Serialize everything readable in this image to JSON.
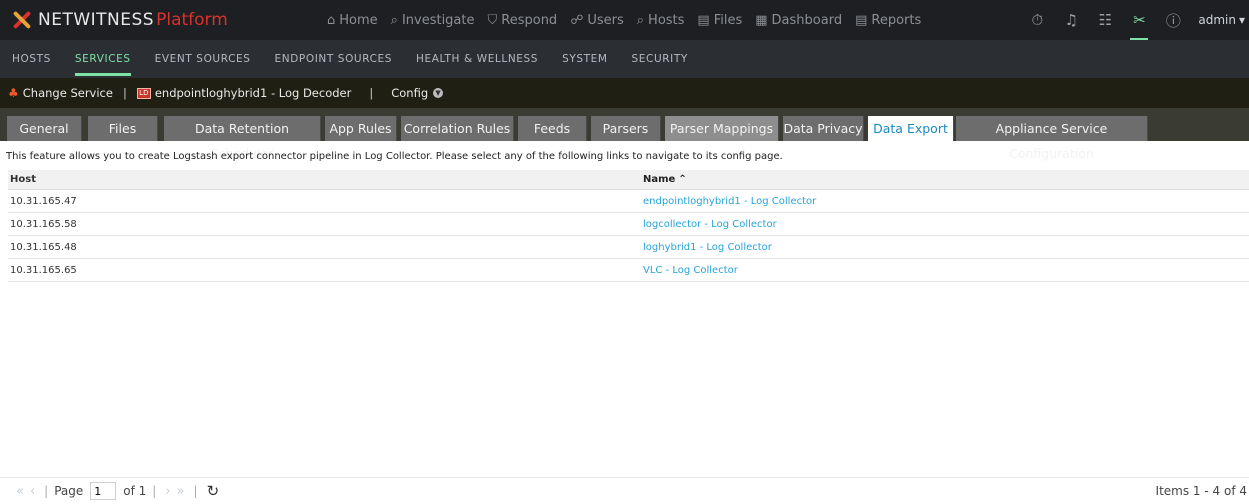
{
  "brand": {
    "name": "NETWITNESS",
    "product": "Platform"
  },
  "main_nav": [
    {
      "label": "Home",
      "icon": "home-icon",
      "glyph": "⌂"
    },
    {
      "label": "Investigate",
      "icon": "investigate-icon",
      "glyph": "⌕"
    },
    {
      "label": "Respond",
      "icon": "respond-icon",
      "glyph": "⛉"
    },
    {
      "label": "Users",
      "icon": "users-icon",
      "glyph": "☍"
    },
    {
      "label": "Hosts",
      "icon": "hosts-icon",
      "glyph": "⌕"
    },
    {
      "label": "Files",
      "icon": "files-icon",
      "glyph": "▤"
    },
    {
      "label": "Dashboard",
      "icon": "dashboard-icon",
      "glyph": "▦"
    },
    {
      "label": "Reports",
      "icon": "reports-icon",
      "glyph": "▤"
    }
  ],
  "right_nav": {
    "user": "admin"
  },
  "sub_nav": [
    "HOSTS",
    "SERVICES",
    "EVENT SOURCES",
    "ENDPOINT SOURCES",
    "HEALTH & WELLNESS",
    "SYSTEM",
    "SECURITY"
  ],
  "service_bar": {
    "change_service": "Change Service",
    "service_badge": "LD",
    "service_name": "endpointloghybrid1 - Log Decoder",
    "config_label": "Config"
  },
  "tabs": [
    "General",
    "Files",
    "Data Retention Scheduler",
    "App Rules",
    "Correlation Rules",
    "Feeds",
    "Parsers",
    "Parser Mappings",
    "Data Privacy",
    "Data Export",
    "Appliance Service Configuration"
  ],
  "content": {
    "description": "This feature allows you to create Logstash export connector pipeline in Log Collector. Please select any of the following links to navigate to its config page.",
    "columns": {
      "host": "Host",
      "name": "Name"
    },
    "rows": [
      {
        "host": "10.31.165.47",
        "name": "endpointloghybrid1 - Log Collector"
      },
      {
        "host": "10.31.165.58",
        "name": "logcollector - Log Collector"
      },
      {
        "host": "10.31.165.48",
        "name": "loghybrid1 - Log Collector"
      },
      {
        "host": "10.31.165.65",
        "name": "VLC - Log Collector"
      }
    ]
  },
  "pagination": {
    "page_label": "Page",
    "page": "1",
    "of_label": "of 1",
    "items": "Items 1 - 4 of 4"
  },
  "colors": {
    "accent": "#7ee2a8",
    "link": "#27a3d8",
    "brand_red": "#d8322c",
    "active_tab_text": "#1a8ac4"
  }
}
